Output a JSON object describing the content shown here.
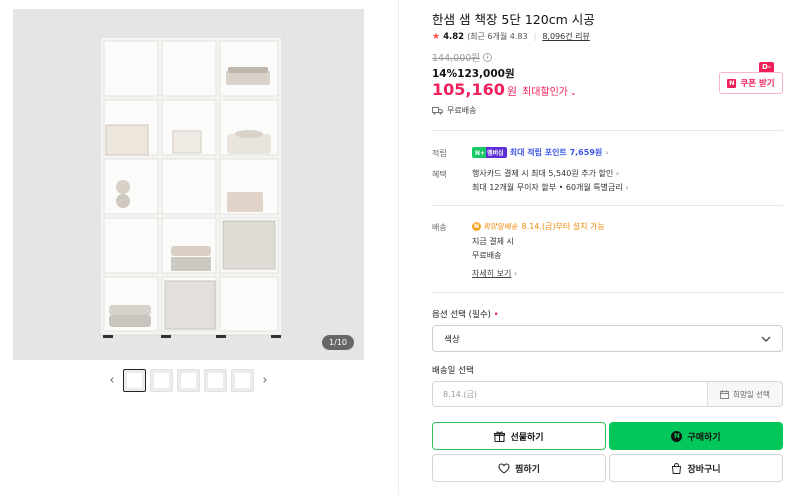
{
  "gallery": {
    "counter": "1/10",
    "thumb_count": 5,
    "prev_glyph": "‹",
    "next_glyph": "›"
  },
  "product": {
    "title": "한샘 샘 책장 5단 120cm 시공",
    "rating": "4.82",
    "rating_recent": "(최근 6개월 4.83",
    "review_count": "8,096건 리뷰",
    "original_price": "144,000원",
    "discount_percent": "14%",
    "sale_price": "123,000원",
    "max_discount_price": "105,160",
    "max_discount_won": "원",
    "max_discount_label": "최대할인가",
    "coupon_dday": "D-6",
    "coupon_label": "쿠폰 받기",
    "delivery_summary": "무료배송"
  },
  "benefits": {
    "point_label": "적립",
    "point_badge": "N+ 멤버십",
    "point_text": "최대 적립 포인트 7,659원",
    "benefit_label": "혜택",
    "benefit_line1": "행사카드 결제 시 최대 5,540원 추가 할인",
    "benefit_line2": "최대 12개월 무이자 할부 • 60개월 특별금리"
  },
  "shipping": {
    "label": "배송",
    "hope_badge": "희망일배송",
    "hope_date": "8.14.(금)부터 설치 가능",
    "pay_now": "지금 결제 시",
    "free": "무료배송",
    "detail_link": "자세히 보기"
  },
  "options": {
    "title": "옵션 선택 (필수)",
    "required_mark": "•",
    "select_value": "색상",
    "date_title": "배송일 선택",
    "date_placeholder": "8.14.(금)",
    "date_button": "희망일 선택"
  },
  "actions": {
    "gift": "선물하기",
    "buy": "구매하기",
    "wish": "찜하기",
    "cart": "장바구니"
  },
  "colors": {
    "accent_pink": "#f0205a",
    "naver_green": "#03c75a",
    "point_blue": "#3d57e6",
    "hope_orange": "#f08a0a"
  }
}
